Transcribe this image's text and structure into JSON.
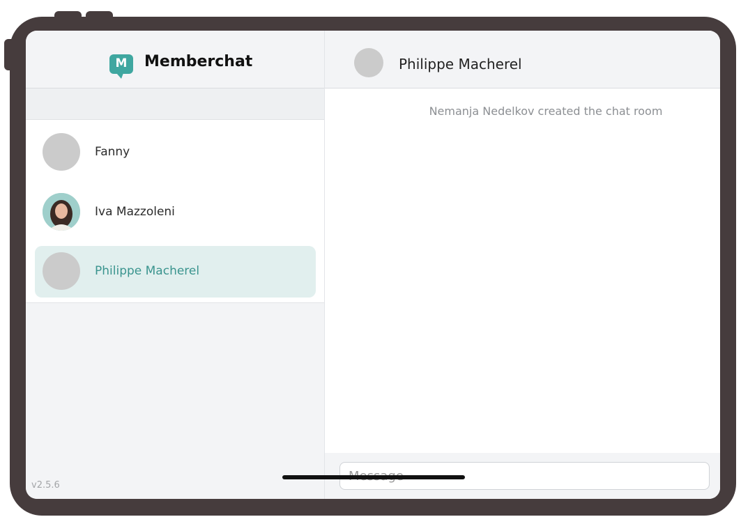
{
  "app": {
    "name": "Memberchat",
    "logo_letter": "M",
    "version": "v2.5.6"
  },
  "colors": {
    "accent": "#3fa7a0",
    "active_bg": "#e1efee",
    "active_text": "#3a948e",
    "device_frame": "#463c3d"
  },
  "conversations": [
    {
      "name": "Fanny",
      "avatar": "placeholder",
      "active": false
    },
    {
      "name": "Iva Mazzoleni",
      "avatar": "photo",
      "active": false
    },
    {
      "name": "Philippe Macherel",
      "avatar": "placeholder",
      "active": true
    }
  ],
  "chat": {
    "title": "Philippe Macherel",
    "system_message": "Nemanja Nedelkov created the chat room",
    "input_placeholder": "Message"
  }
}
